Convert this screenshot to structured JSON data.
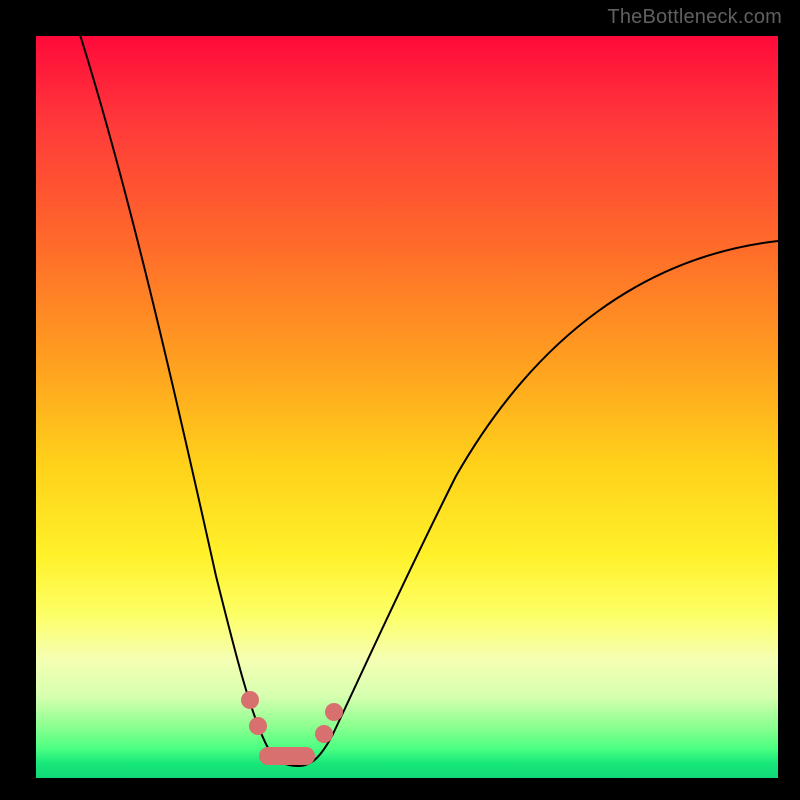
{
  "watermark": "TheBottleneck.com",
  "colors": {
    "frame": "#000000",
    "curve": "#000000",
    "marker": "#d7706f"
  },
  "chart_data": {
    "type": "line",
    "title": "",
    "xlabel": "",
    "ylabel": "",
    "x": [
      0,
      0.05,
      0.1,
      0.15,
      0.2,
      0.24,
      0.28,
      0.3,
      0.32,
      0.34,
      0.36,
      0.4,
      0.45,
      0.5,
      0.6,
      0.7,
      0.8,
      0.9,
      1.0
    ],
    "values": [
      1.1,
      0.98,
      0.85,
      0.7,
      0.52,
      0.33,
      0.12,
      0.03,
      0.0,
      0.0,
      0.02,
      0.09,
      0.2,
      0.32,
      0.5,
      0.6,
      0.66,
      0.69,
      0.7
    ],
    "xlim": [
      0,
      1
    ],
    "ylim": [
      0,
      1.1
    ],
    "annotations": [
      "TheBottleneck.com"
    ],
    "marker_region_x": [
      0.28,
      0.4
    ],
    "marker_region_note": "highlighted salmon dots near curve minimum"
  }
}
